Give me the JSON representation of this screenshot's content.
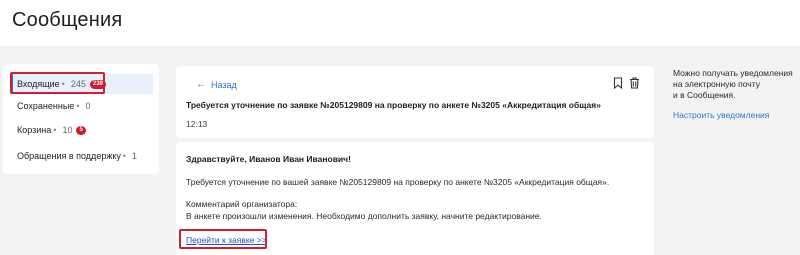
{
  "page": {
    "title": "Сообщения"
  },
  "sidebar": {
    "items": [
      {
        "label": "Входящие",
        "count": "245",
        "badge": "239",
        "active": true
      },
      {
        "label": "Сохраненные",
        "count": "0",
        "badge": null,
        "active": false
      },
      {
        "label": "Корзина",
        "count": "10",
        "badge": "5",
        "active": false
      },
      {
        "label": "Обращения в поддержку",
        "count": "1",
        "badge": null,
        "active": false
      }
    ],
    "separator": "•"
  },
  "message": {
    "back_label": "Назад",
    "subject": "Требуется уточнение по заявке №205129809 на проверку по анкете №3205 «Аккредитация общая»",
    "time": "12:13",
    "greeting": "Здравствуйте, Иванов Иван Иванович!",
    "paragraph1": "Требуется уточнение по вашей заявке №205129809 на проверку по анкете №3205 «Аккредитация общая».",
    "paragraph2": "Комментарий организатора:",
    "paragraph3": "В анкете произошли изменения. Необходимо дополнить заявку, начните редактирование.",
    "link_label": "Перейти к заявке >>"
  },
  "right_panel": {
    "info_lines": [
      "Можно получать уведомления",
      "на электронную почту",
      "и в Сообщения."
    ],
    "settings_link": "Настроить уведомления"
  },
  "colors": {
    "accent": "#2a78d4",
    "badge": "#d11d2a",
    "highlight": "#d21f2a"
  }
}
